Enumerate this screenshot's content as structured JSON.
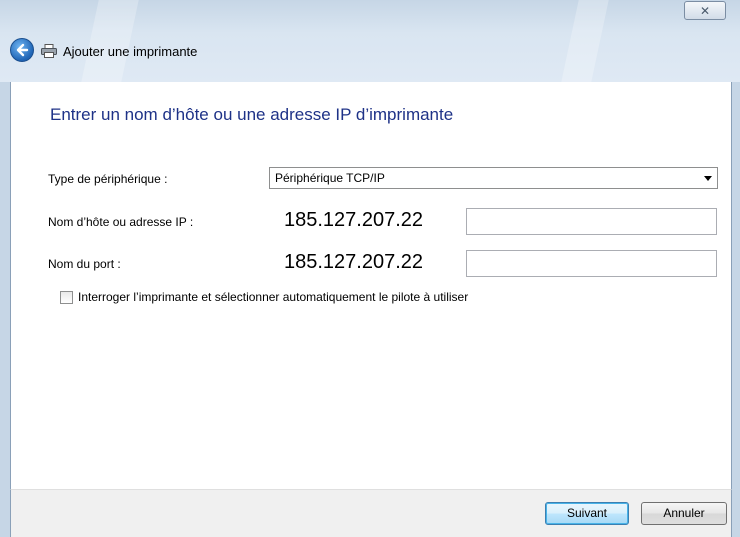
{
  "window": {
    "title": "Ajouter une imprimante",
    "close_glyph": "✕"
  },
  "icons": {
    "back": "back-arrow-icon",
    "printer": "printer-icon",
    "close": "close-icon",
    "dropdown": "chevron-down-icon"
  },
  "page": {
    "heading": "Entrer un nom d’hôte ou une adresse IP d’imprimante"
  },
  "form": {
    "device_type_label": "Type de périphérique :",
    "device_type_value": "Périphérique TCP/IP",
    "hostname_label": "Nom d’hôte ou adresse IP :",
    "hostname_value": "185.127.207.22",
    "port_label": "Nom du port :",
    "port_value": "185.127.207.22",
    "query_checkbox_label": "Interroger l’imprimante et sélectionner automatiquement le pilote à utiliser",
    "query_checkbox_checked": false
  },
  "footer": {
    "next_label": "Suivant",
    "cancel_label": "Annuler"
  },
  "colors": {
    "heading": "#1e3287",
    "titlebar": "#d9e5f1",
    "primary_button_border": "#3c7fb1"
  }
}
